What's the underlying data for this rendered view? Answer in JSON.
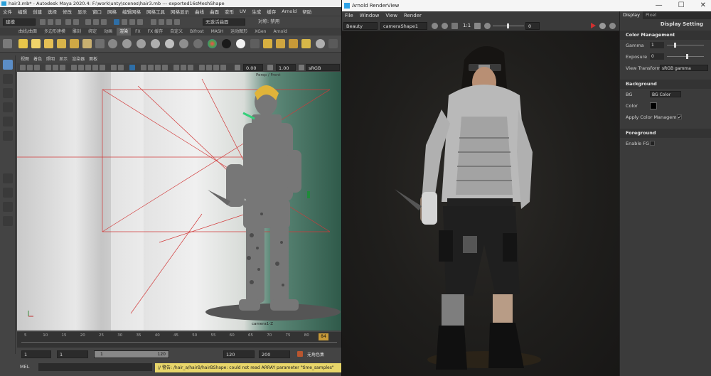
{
  "maya": {
    "title": "hair3.mb* - Autodesk Maya 2020.4: F:\\work\\unty\\scenes\\hair3.mb  ---  exported16sMeshShape",
    "menu": [
      "文件",
      "编辑",
      "创建",
      "选择",
      "修改",
      "显示",
      "窗口",
      "网格",
      "编辑网格",
      "网格工具",
      "网格显示",
      "曲线",
      "曲面",
      "变形",
      "UV",
      "生成",
      "缓存",
      "Arnold",
      "帮助"
    ],
    "mode_dropdown": "建模",
    "status_field": "无激活曲面",
    "symmetry": "对称: 禁用",
    "shelf_tabs": [
      "曲线/曲面",
      "多边形建模",
      "雕刻",
      "绑定",
      "动画",
      "渲染",
      "FX",
      "FX 缓存",
      "自定义",
      "Bifrost",
      "MASH",
      "运动图形",
      "XGen",
      "Arnold"
    ],
    "active_shelf_tab": "渲染",
    "panel_menu": [
      "视图",
      "着色",
      "照明",
      "显示",
      "渲染器",
      "面板"
    ],
    "exposure": "0.00",
    "gamma": "1.00",
    "colorspace": "sRGB gamma",
    "camera_label": "camera1-Z",
    "top_label": "Persp / Front",
    "timeline_ticks": [
      "5",
      "10",
      "15",
      "20",
      "25",
      "30",
      "35",
      "40",
      "45",
      "50",
      "55",
      "60",
      "65",
      "70",
      "75",
      "80",
      "85"
    ],
    "current_frame": "84",
    "range": {
      "start": "1",
      "start2": "1",
      "slider_start": "1",
      "slider_end": "120",
      "end": "120",
      "end2": "200",
      "char_set": "无角色集"
    },
    "mel_label": "MEL",
    "warning": "// 警告: /hair_a/hairB/hairBShape: could not read ARRAY parameter \"time_samples\""
  },
  "arnold": {
    "title": "Arnold RenderView",
    "window_controls": [
      "—",
      "☐",
      "✕"
    ],
    "menu": [
      "File",
      "Window",
      "View",
      "Render"
    ],
    "aov": "Beauty",
    "camera": "cameraShape1",
    "ratio": "1:1",
    "exposure_value": "0",
    "side_tabs": [
      "Display",
      "Pixel"
    ],
    "active_side_tab": "Display",
    "panel_title": "Display Setting",
    "color_management": {
      "heading": "Color Management",
      "gamma_label": "Gamma",
      "gamma_value": "1",
      "gamma_slider": 0.2,
      "exposure_label": "Exposure",
      "exposure_value": "0",
      "exposure_slider": 0.55,
      "view_transform_label": "View Transform",
      "view_transform_value": "sRGB gamma"
    },
    "background": {
      "heading": "Background",
      "bg_label": "BG",
      "bg_value": "BG Color",
      "color_label": "Color",
      "color_value": "#000000",
      "apply_label": "Apply Color Manageme",
      "apply_checked": "✓"
    },
    "foreground": {
      "heading": "Foreground",
      "enable_label": "Enable FG"
    }
  },
  "colors": {
    "accent_blue": "#2ea3e8",
    "warning_yellow": "#e8d66a",
    "render_stop_red": "#d03030"
  }
}
